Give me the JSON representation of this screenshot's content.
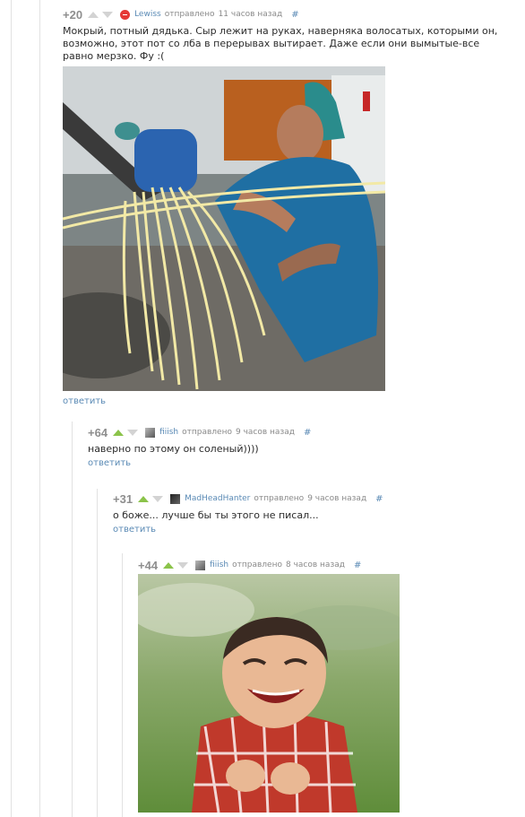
{
  "comments": [
    {
      "rating": "+20",
      "username": "Lewiss",
      "posted_label": "отправлено",
      "time": "11 часов назад",
      "hash": "#",
      "text": "Мокрый, потный дядька. Сыр лежит на руках, наверняка волосатых, которыми он, возможно, этот пот со лба в перерывах вытирает. Даже если они вымытые-все равно мерзко. Фу :(",
      "reply_label": "ответить",
      "image_subject": "worker-pulling-cheese-strands"
    },
    {
      "rating": "+64",
      "username": "fiiish",
      "posted_label": "отправлено",
      "time": "9 часов назад",
      "hash": "#",
      "text": "наверно по этому он соленый))))",
      "reply_label": "ответить"
    },
    {
      "rating": "+31",
      "username": "MadHeadHanter",
      "posted_label": "отправлено",
      "time": "9 часов назад",
      "hash": "#",
      "text": "о боже... лучше бы ты этого не писал...",
      "reply_label": "ответить"
    },
    {
      "rating": "+44",
      "username": "fiiish",
      "posted_label": "отправлено",
      "time": "8 часов назад",
      "hash": "#",
      "image_subject": "evil-toddler-meme"
    }
  ],
  "colors": {
    "upvote_active": "#8bc34a",
    "link": "#5a8ab5",
    "rating": "#8e8e8e"
  }
}
